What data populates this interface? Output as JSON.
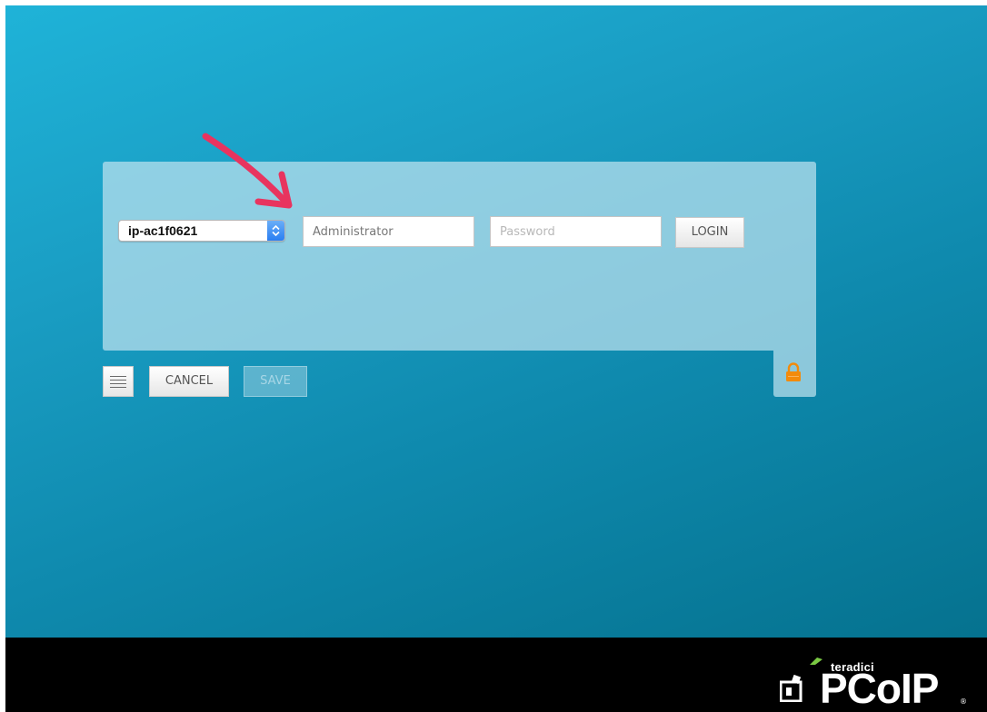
{
  "login": {
    "host_value": "ip-ac1f0621",
    "username_value": "Administrator",
    "password_placeholder": "Password",
    "login_label": "LOGIN"
  },
  "toolbar": {
    "menu_icon": "hamburger-menu-icon",
    "cancel_label": "CANCEL",
    "save_label": "SAVE"
  },
  "lock": {
    "icon": "lock-icon",
    "color": "#f28b0c"
  },
  "annotation": {
    "arrow_color": "#e8345f"
  },
  "brand": {
    "small": "teradici",
    "large": "PCoIP",
    "registered": "®"
  },
  "colors": {
    "desktop_top": "#1fb3d8",
    "desktop_bottom": "#05728f",
    "taskbar": "#000000"
  }
}
